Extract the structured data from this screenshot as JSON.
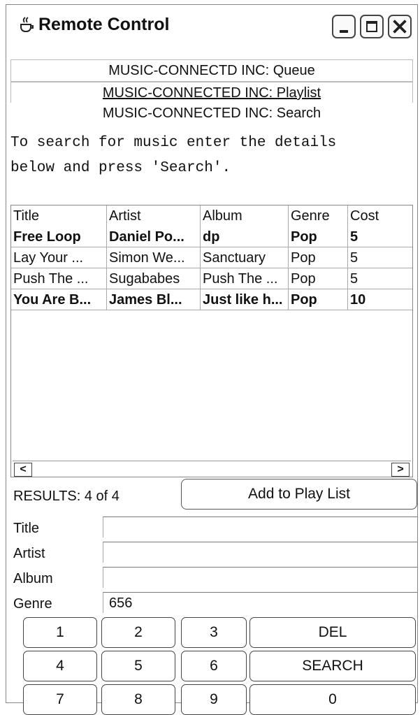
{
  "window": {
    "title": "Remote Control",
    "icon": "java-cup-icon"
  },
  "nav": {
    "queue": "MUSIC-CONNECTD INC: Queue",
    "playlist": "MUSIC-CONNECTED INC: Playlist",
    "search": "MUSIC-CONNECTED INC: Search"
  },
  "instructions": {
    "line1": "To search for music enter the details",
    "line2": "below and press 'Search'."
  },
  "table": {
    "headers": [
      "Title",
      "Artist",
      "Album",
      "Genre",
      "Cost"
    ],
    "rows": [
      [
        "Free Loop",
        "Daniel Po...",
        "dp",
        "Pop",
        "5"
      ],
      [
        "Lay Your ...",
        "Simon We...",
        "Sanctuary",
        "Pop",
        "5"
      ],
      [
        "Push The ...",
        "Sugababes",
        "Push The ...",
        "Pop",
        "5"
      ],
      [
        "You Are B...",
        "James Bl...",
        "Just like h...",
        "Pop",
        "10"
      ]
    ]
  },
  "scroll": {
    "left": "<",
    "right": ">"
  },
  "results": "RESULTS: 4 of 4",
  "add_button": "Add to Play List",
  "form": {
    "title_label": "Title",
    "title_value": "",
    "artist_label": "Artist",
    "artist_value": "",
    "album_label": "Album",
    "album_value": "",
    "genre_label": "Genre",
    "genre_value": "656"
  },
  "keypad": {
    "k1": "1",
    "k2": "2",
    "k3": "3",
    "del": "DEL",
    "k4": "4",
    "k5": "5",
    "k6": "6",
    "search": "SEARCH",
    "k7": "7",
    "k8": "8",
    "k9": "9",
    "k0": "0"
  }
}
